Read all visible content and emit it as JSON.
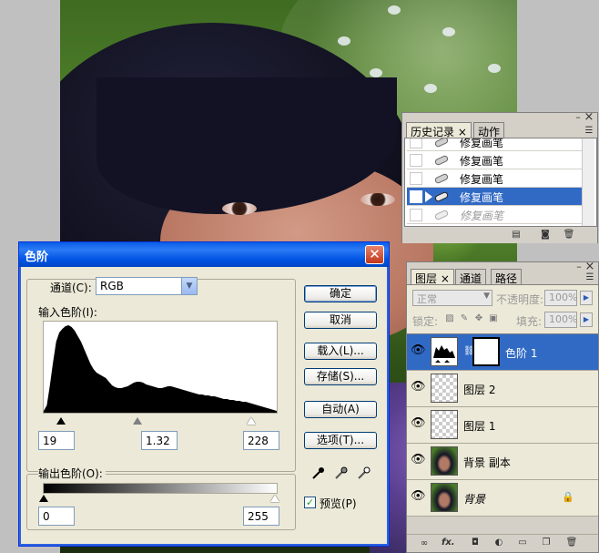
{
  "levels_dialog": {
    "title": "色阶",
    "close_symbol": "✕",
    "channel_label": "通道(C):",
    "channel_value": "RGB",
    "input_levels_label": "输入色阶(I):",
    "input_black": "19",
    "input_gamma": "1.32",
    "input_white": "228",
    "output_levels_label": "输出色阶(O):",
    "output_black": "0",
    "output_white": "255",
    "buttons": {
      "ok": "确定",
      "cancel": "取消",
      "load": "载入(L)...",
      "save": "存储(S)...",
      "auto": "自动(A)",
      "options": "选项(T)..."
    },
    "preview_label": "预览(P)",
    "preview_checked": true,
    "histogram": [
      2,
      8,
      30,
      55,
      78,
      88,
      92,
      95,
      96,
      94,
      90,
      84,
      78,
      70,
      62,
      54,
      48,
      44,
      42,
      40,
      38,
      34,
      30,
      28,
      27,
      27,
      28,
      29,
      31,
      33,
      34,
      34,
      33,
      31,
      30,
      29,
      28,
      27,
      27,
      28,
      29,
      29,
      28,
      27,
      26,
      25,
      24,
      23,
      22,
      21,
      20,
      20,
      19,
      19,
      18,
      18,
      17,
      16,
      15,
      15,
      14,
      14,
      13,
      13,
      12,
      12,
      11,
      10,
      9,
      8,
      7,
      6,
      5,
      4,
      3,
      2
    ]
  },
  "history_panel": {
    "tabs": [
      {
        "label": "历史记录",
        "active": true
      },
      {
        "label": "动作",
        "active": false
      }
    ],
    "close_symbol": "×",
    "items": [
      {
        "label": "修复画笔",
        "state": "normal"
      },
      {
        "label": "修复画笔",
        "state": "normal"
      },
      {
        "label": "修复画笔",
        "state": "normal"
      },
      {
        "label": "修复画笔",
        "state": "selected"
      },
      {
        "label": "修复画笔",
        "state": "undone"
      }
    ]
  },
  "layers_panel": {
    "tabs": [
      {
        "label": "图层",
        "active": true
      },
      {
        "label": "通道",
        "active": false
      },
      {
        "label": "路径",
        "active": false
      }
    ],
    "close_symbol": "×",
    "blend_mode": "正常",
    "opacity_label": "不透明度:",
    "opacity_value": "100%",
    "lock_label": "锁定:",
    "fill_label": "填充:",
    "fill_value": "100%",
    "layers": [
      {
        "name": "色阶 1",
        "type": "adjustment",
        "selected": true
      },
      {
        "name": "图层 2",
        "type": "transparent",
        "selected": false
      },
      {
        "name": "图层 1",
        "type": "transparent",
        "selected": false
      },
      {
        "name": "背景 副本",
        "type": "photo",
        "selected": false
      },
      {
        "name": "背景",
        "type": "background",
        "selected": false,
        "locked": true
      }
    ],
    "bottom_icons": [
      "link-icon",
      "fx-icon",
      "mask-icon",
      "adjustment-icon",
      "folder-icon",
      "new-layer-icon",
      "trash-icon"
    ],
    "fx_text": "fx."
  }
}
